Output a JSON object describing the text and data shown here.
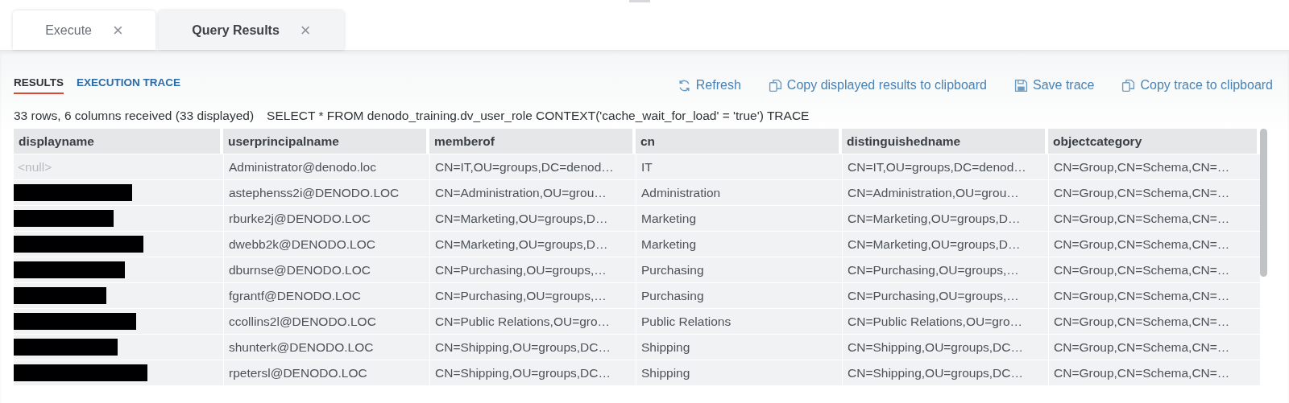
{
  "tabs": [
    {
      "label": "Execute",
      "close": "×",
      "selected": false
    },
    {
      "label": "Query Results",
      "close": "×",
      "selected": true
    }
  ],
  "view_tabs": [
    {
      "label": "RESULTS",
      "selected": true
    },
    {
      "label": "EXECUTION TRACE",
      "selected": false
    }
  ],
  "actions": [
    {
      "kind": "refresh",
      "label": "Refresh"
    },
    {
      "kind": "copy",
      "label": "Copy displayed results to clipboard"
    },
    {
      "kind": "save",
      "label": "Save trace"
    },
    {
      "kind": "copy",
      "label": "Copy trace to clipboard"
    }
  ],
  "summary": "33 rows, 6 columns received (33 displayed)",
  "query": "SELECT * FROM denodo_training.dv_user_role CONTEXT('cache_wait_for_load' = 'true') TRACE",
  "table": {
    "columns": [
      "displayname",
      "userprincipalname",
      "memberof",
      "cn",
      "distinguishedname",
      "objectcategory"
    ],
    "rows": [
      [
        {
          "kind": "null",
          "text": "<null>"
        },
        {
          "kind": "text",
          "text": "Administrator@denodo.loc"
        },
        {
          "kind": "text",
          "text": "CN=IT,OU=groups,DC=denod…"
        },
        {
          "kind": "text",
          "text": "IT"
        },
        {
          "kind": "text",
          "text": "CN=IT,OU=groups,DC=denod…"
        },
        {
          "kind": "text",
          "text": "CN=Group,CN=Schema,CN=…"
        }
      ],
      [
        {
          "kind": "redacted"
        },
        {
          "kind": "text",
          "text": "astephenss2i@DENODO.LOC"
        },
        {
          "kind": "text",
          "text": "CN=Administration,OU=grou…"
        },
        {
          "kind": "text",
          "text": "Administration"
        },
        {
          "kind": "text",
          "text": "CN=Administration,OU=grou…"
        },
        {
          "kind": "text",
          "text": "CN=Group,CN=Schema,CN=…"
        }
      ],
      [
        {
          "kind": "redacted"
        },
        {
          "kind": "text",
          "text": "rburke2j@DENODO.LOC"
        },
        {
          "kind": "text",
          "text": "CN=Marketing,OU=groups,D…"
        },
        {
          "kind": "text",
          "text": "Marketing"
        },
        {
          "kind": "text",
          "text": "CN=Marketing,OU=groups,D…"
        },
        {
          "kind": "text",
          "text": "CN=Group,CN=Schema,CN=…"
        }
      ],
      [
        {
          "kind": "redacted"
        },
        {
          "kind": "text",
          "text": "dwebb2k@DENODO.LOC"
        },
        {
          "kind": "text",
          "text": "CN=Marketing,OU=groups,D…"
        },
        {
          "kind": "text",
          "text": "Marketing"
        },
        {
          "kind": "text",
          "text": "CN=Marketing,OU=groups,D…"
        },
        {
          "kind": "text",
          "text": "CN=Group,CN=Schema,CN=…"
        }
      ],
      [
        {
          "kind": "redacted"
        },
        {
          "kind": "text",
          "text": "dburnse@DENODO.LOC"
        },
        {
          "kind": "text",
          "text": "CN=Purchasing,OU=groups,…"
        },
        {
          "kind": "text",
          "text": "Purchasing"
        },
        {
          "kind": "text",
          "text": "CN=Purchasing,OU=groups,…"
        },
        {
          "kind": "text",
          "text": "CN=Group,CN=Schema,CN=…"
        }
      ],
      [
        {
          "kind": "redacted"
        },
        {
          "kind": "text",
          "text": "fgrantf@DENODO.LOC"
        },
        {
          "kind": "text",
          "text": "CN=Purchasing,OU=groups,…"
        },
        {
          "kind": "text",
          "text": "Purchasing"
        },
        {
          "kind": "text",
          "text": "CN=Purchasing,OU=groups,…"
        },
        {
          "kind": "text",
          "text": "CN=Group,CN=Schema,CN=…"
        }
      ],
      [
        {
          "kind": "redacted"
        },
        {
          "kind": "text",
          "text": "ccollins2l@DENODO.LOC"
        },
        {
          "kind": "text",
          "text": "CN=Public Relations,OU=gro…"
        },
        {
          "kind": "text",
          "text": "Public Relations"
        },
        {
          "kind": "text",
          "text": "CN=Public Relations,OU=gro…"
        },
        {
          "kind": "text",
          "text": "CN=Group,CN=Schema,CN=…"
        }
      ],
      [
        {
          "kind": "redacted"
        },
        {
          "kind": "text",
          "text": "shunterk@DENODO.LOC"
        },
        {
          "kind": "text",
          "text": "CN=Shipping,OU=groups,DC…"
        },
        {
          "kind": "text",
          "text": "Shipping"
        },
        {
          "kind": "text",
          "text": "CN=Shipping,OU=groups,DC…"
        },
        {
          "kind": "text",
          "text": "CN=Group,CN=Schema,CN=…"
        }
      ],
      [
        {
          "kind": "redacted"
        },
        {
          "kind": "text",
          "text": "rpetersl@DENODO.LOC"
        },
        {
          "kind": "text",
          "text": "CN=Shipping,OU=groups,DC…"
        },
        {
          "kind": "text",
          "text": "Shipping"
        },
        {
          "kind": "text",
          "text": "CN=Shipping,OU=groups,DC…"
        },
        {
          "kind": "text",
          "text": "CN=Group,CN=Schema,CN=…"
        }
      ]
    ]
  }
}
